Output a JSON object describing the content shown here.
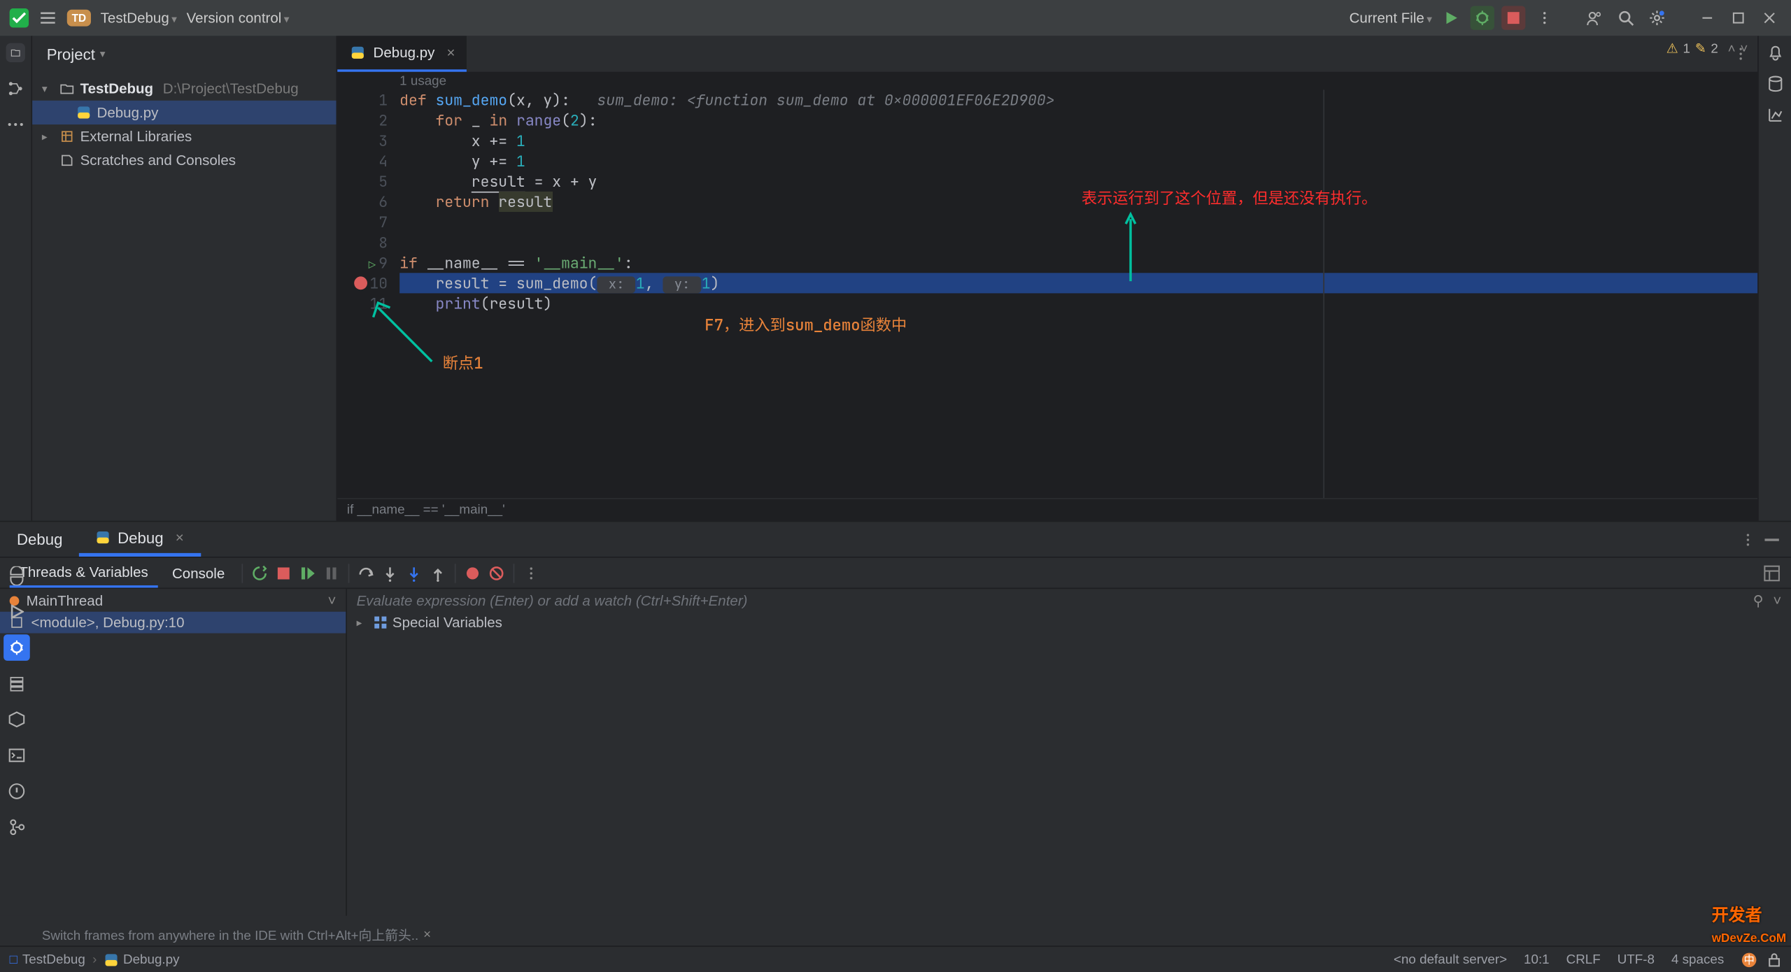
{
  "titlebar": {
    "project_name": "TestDebug",
    "vcs_label": "Version control",
    "badge": "TD",
    "current_config": "Current File"
  },
  "project_pane": {
    "header": "Project",
    "root": "TestDebug",
    "root_path": "D:\\Project\\TestDebug",
    "file": "Debug.py",
    "external": "External Libraries",
    "scratches": "Scratches and Consoles"
  },
  "editor": {
    "tab_name": "Debug.py",
    "usages": "1 usage",
    "warn_count": "1",
    "typo_count": "2",
    "breadcrumb": "if __name__ == '__main__'",
    "lines": [
      "1",
      "2",
      "3",
      "4",
      "5",
      "6",
      "7",
      "8",
      "9",
      "10",
      "11"
    ]
  },
  "code": {
    "l1_def": "def ",
    "l1_fn": "sum_demo",
    "l1_params": "(x, y):   ",
    "l1_hint": "sum_demo: <function sum_demo at 0x000001EF06E2D900>",
    "l2": "    for _ in range(2):",
    "l2_kw1": "for ",
    "l2_mid": "_ ",
    "l2_kw2": "in ",
    "l2_fn": "range",
    "l2_rest": "(",
    "l2_num": "2",
    "l2_end": "):",
    "l3": "        x += ",
    "l3_num": "1",
    "l4": "        y += ",
    "l4_num": "1",
    "l5a": "        ",
    "l5b": "result",
    "l5c": " = x + y",
    "l6a": "    ",
    "l6_kw": "return ",
    "l6b": "result",
    "l9_kw": "if ",
    "l9_a": "__name__ == ",
    "l9_str": "'__main__'",
    "l9_end": ":",
    "l10a": "    result = sum_demo(",
    "l10_h1": " x: ",
    "l10_v1": "1",
    "l10_c": ", ",
    "l10_h2": " y: ",
    "l10_v2": "1",
    "l10_end": ")",
    "l11a": "    ",
    "l11_fn": "print",
    "l11b": "(result)"
  },
  "annotations": {
    "top": "表示运行到了这个位置，但是还没有执行。",
    "mid": "F7，进入到sum_demo函数中",
    "bp": "断点1"
  },
  "debug": {
    "tab_debug": "Debug",
    "tab_run": "Debug",
    "threads_vars": "Threads & Variables",
    "console": "Console",
    "main_thread": "MainThread",
    "frame": "<module>, Debug.py:10",
    "watch_placeholder": "Evaluate expression (Enter) or add a watch (Ctrl+Shift+Enter)",
    "special_vars": "Special Variables"
  },
  "statusbar": {
    "hint_text": "Switch frames from anywhere in the IDE with Ctrl+Alt+向上箭头..",
    "crumb1": "TestDebug",
    "crumb2": "Debug.py",
    "server": "<no default server>",
    "pos": "10:1",
    "eol": "CRLF",
    "enc": "UTF-8",
    "indent": "4 spaces"
  },
  "watermark": "开发者\nwDevZe.CoM"
}
